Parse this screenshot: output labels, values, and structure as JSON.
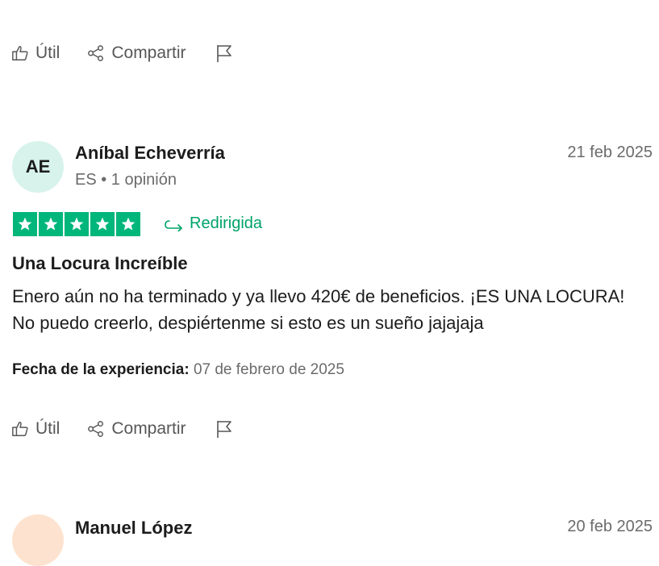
{
  "top_actions": {
    "useful_label": "Útil",
    "share_label": "Compartir"
  },
  "review": {
    "avatar_initials": "AE",
    "reviewer_name": "Aníbal Echeverría",
    "reviewer_meta": "ES • 1 opinión",
    "date": "21 feb 2025",
    "rating": 5,
    "redirected_label": "Redirigida",
    "title": "Una Locura Increíble",
    "body": "Enero aún no ha terminado y ya llevo 420€ de beneficios. ¡ES UNA LOCURA! No puedo creerlo, despiértenme si esto es un sueño jajajaja",
    "experience_label": "Fecha de la experiencia:",
    "experience_date": "07 de febrero de 2025",
    "useful_label": "Útil",
    "share_label": "Compartir"
  },
  "next_review": {
    "reviewer_name": "Manuel López",
    "date": "20 feb 2025"
  },
  "colors": {
    "star_green": "#00b67a",
    "redirect_green": "#00a369",
    "avatar_mint": "#d7f3eb",
    "avatar_peach": "#fde3cf"
  },
  "icons": [
    "thumbs-up-icon",
    "share-icon",
    "flag-icon",
    "star-icon",
    "redirect-arrow-icon"
  ]
}
